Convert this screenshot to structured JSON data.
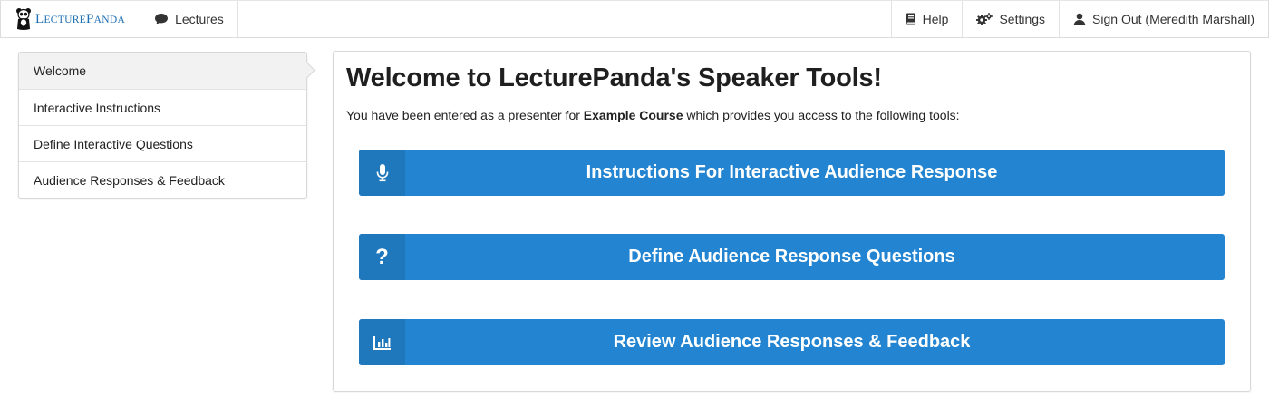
{
  "navbar": {
    "brand": {
      "first_letter": "L",
      "rest1": "ECTURE",
      "second_letter": "P",
      "rest2": "ANDA"
    },
    "lectures_label": "Lectures",
    "help_label": "Help",
    "settings_label": "Settings",
    "signout_label": "Sign Out (Meredith Marshall)"
  },
  "sidebar": {
    "items": [
      {
        "label": "Welcome",
        "active": true
      },
      {
        "label": "Interactive Instructions"
      },
      {
        "label": "Define Interactive Questions"
      },
      {
        "label": "Audience Responses & Feedback"
      }
    ]
  },
  "main": {
    "title": "Welcome to LecturePanda's Speaker Tools!",
    "intro_prefix": "You have been entered as a presenter for ",
    "intro_course": "Example Course",
    "intro_suffix": " which provides you access to the following tools:",
    "tools": [
      {
        "label": "Instructions For Interactive Audience Response",
        "icon": "microphone-icon"
      },
      {
        "label": "Define Audience Response Questions",
        "icon": "question-icon"
      },
      {
        "label": "Review Audience Responses & Feedback",
        "icon": "bar-chart-icon"
      }
    ]
  },
  "colors": {
    "accent": "#2385d1",
    "accent_dark": "#1f77bc",
    "brand": "#1e6fb3"
  }
}
